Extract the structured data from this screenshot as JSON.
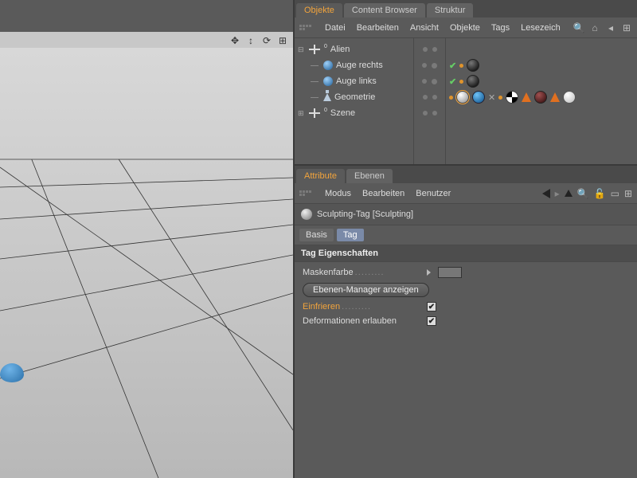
{
  "objects_panel": {
    "tabs": [
      "Objekte",
      "Content Browser",
      "Struktur"
    ],
    "active_tab": 0,
    "menu": [
      "Datei",
      "Bearbeiten",
      "Ansicht",
      "Objekte",
      "Tags",
      "Lesezeich"
    ],
    "tree": {
      "root": {
        "name": "Alien",
        "expanded": true
      },
      "children": [
        {
          "name": "Auge rechts",
          "icon": "sphere"
        },
        {
          "name": "Auge links",
          "icon": "sphere"
        },
        {
          "name": "Geometrie",
          "icon": "flask"
        }
      ],
      "sibling": {
        "name": "Szene",
        "expanded": false
      }
    }
  },
  "attributes_panel": {
    "tabs": [
      "Attribute",
      "Ebenen"
    ],
    "active_tab": 0,
    "menu": [
      "Modus",
      "Bearbeiten",
      "Benutzer"
    ],
    "header": "Sculpting-Tag [Sculpting]",
    "mini_tabs": [
      "Basis",
      "Tag"
    ],
    "mini_active": 1,
    "section": "Tag Eigenschaften",
    "props": {
      "maskenfarbe_label": "Maskenfarbe",
      "ebenen_manager_btn": "Ebenen-Manager anzeigen",
      "einfrieren_label": "Einfrieren",
      "einfrieren_checked": true,
      "deform_label": "Deformationen erlauben",
      "deform_checked": true
    }
  }
}
